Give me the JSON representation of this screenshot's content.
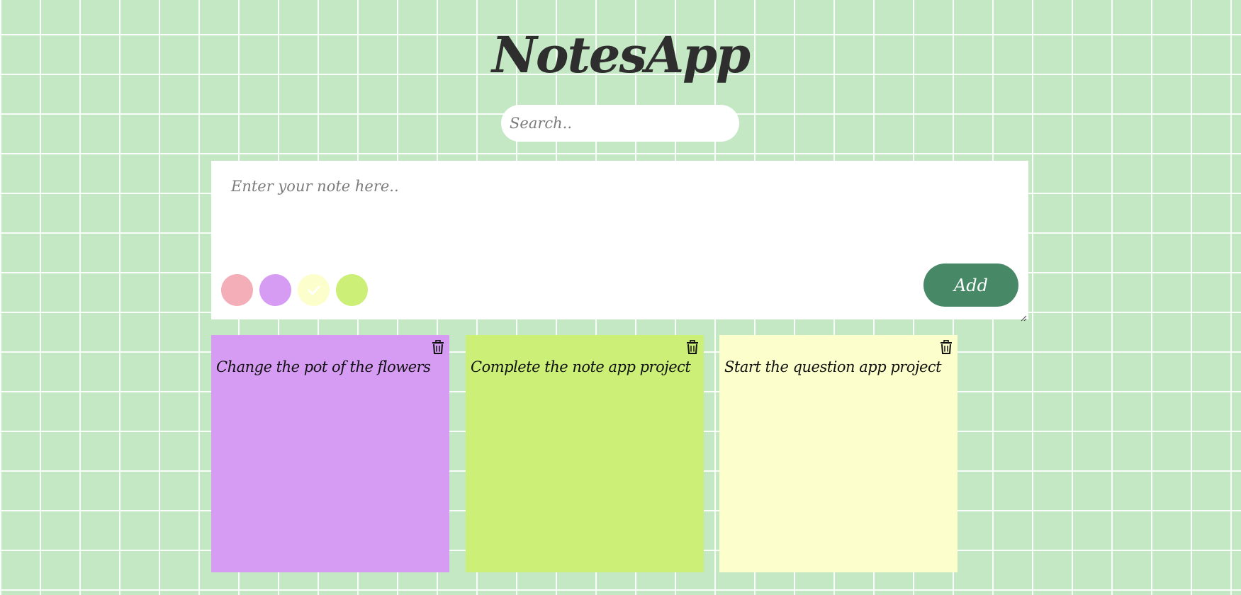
{
  "app": {
    "title": "NotesApp"
  },
  "search": {
    "placeholder": "Search.."
  },
  "composer": {
    "placeholder": "Enter your note here..",
    "add_label": "Add",
    "add_color": "#478966",
    "swatches": [
      {
        "name": "pink",
        "color": "#f4aeb8",
        "selected": false
      },
      {
        "name": "purple",
        "color": "#d69cf4",
        "selected": false
      },
      {
        "name": "yellow",
        "color": "#fcffcb",
        "selected": true
      },
      {
        "name": "lime",
        "color": "#cbef77",
        "selected": false
      }
    ]
  },
  "notes": [
    {
      "text": "Change the pot of the flowers",
      "color": "#d69cf4",
      "icon": "trash-icon"
    },
    {
      "text": "Complete the note app project",
      "color": "#cbef77",
      "icon": "trash-icon"
    },
    {
      "text": "Start the question app project",
      "color": "#fcffcb",
      "icon": "trash-icon"
    }
  ]
}
